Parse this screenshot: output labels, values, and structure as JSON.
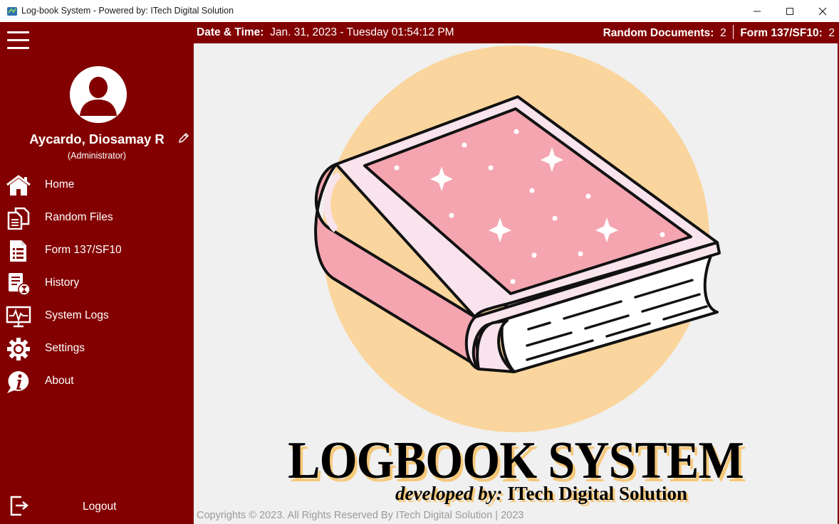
{
  "window": {
    "title": "Log-book System - Powered by: ITech Digital Solution",
    "controls": [
      "minimize",
      "maximize",
      "close"
    ]
  },
  "sidebar": {
    "user": {
      "name": "Aycardo, Diosamay R",
      "role": "(Administrator)"
    },
    "items": [
      {
        "label": "Home",
        "icon": "home-icon"
      },
      {
        "label": "Random Files",
        "icon": "documents-icon"
      },
      {
        "label": "Form 137/SF10",
        "icon": "list-document-icon"
      },
      {
        "label": "History",
        "icon": "history-icon"
      },
      {
        "label": "System Logs",
        "icon": "monitor-pulse-icon"
      },
      {
        "label": "Settings",
        "icon": "gear-icon"
      },
      {
        "label": "About",
        "icon": "info-icon"
      }
    ],
    "logout": "Logout"
  },
  "topbar": {
    "datetime_label": "Date & Time:",
    "datetime_value": "Jan. 31, 2023 - Tuesday 01:54:12 PM",
    "random_docs_label": "Random Documents:",
    "random_docs_count": "2",
    "form137_label": "Form 137/SF10:",
    "form137_count": "2"
  },
  "main": {
    "logo_title": "LOGBOOK SYSTEM",
    "dev_prefix": "developed by:",
    "dev_name": "ITech Digital Solution",
    "footer": "Copyrights © 2023. All Rights Reserved By ITech Digital Solution | 2023"
  },
  "colors": {
    "brand": "#820000",
    "main_bg": "#f0f0f0",
    "accent_circle": "#fad59e",
    "book_pink": "#f4a5b0"
  }
}
